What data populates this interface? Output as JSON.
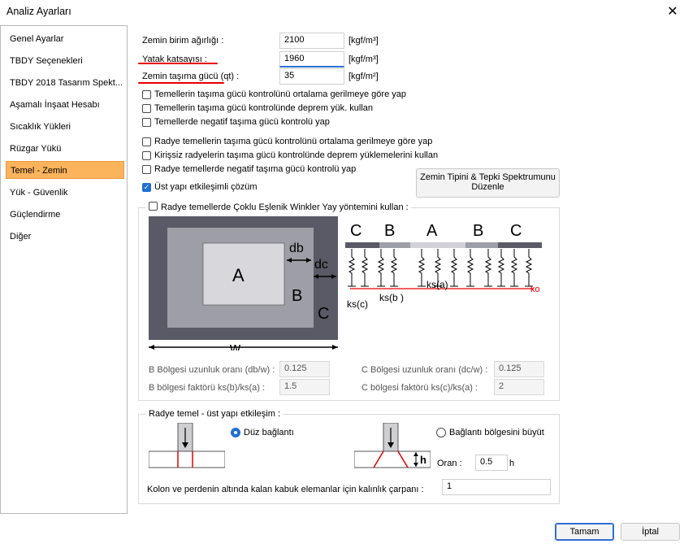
{
  "window": {
    "title": "Analiz Ayarları",
    "close_glyph": "✕"
  },
  "sidebar": {
    "items": [
      {
        "label": "Genel Ayarlar"
      },
      {
        "label": "TBDY Seçenekleri"
      },
      {
        "label": "TBDY 2018 Tasarım Spekt..."
      },
      {
        "label": "Aşamalı İnşaat Hesabı"
      },
      {
        "label": "Sıcaklık Yükleri"
      },
      {
        "label": "Rüzgar Yükü"
      },
      {
        "label": "Temel - Zemin"
      },
      {
        "label": "Yük - Güvenlik"
      },
      {
        "label": "Güçlendirme"
      },
      {
        "label": "Diğer"
      }
    ],
    "selected": "Temel - Zemin"
  },
  "soil": {
    "unit_weight": {
      "label": "Zemin birim ağırlığı :",
      "value": "2100",
      "unit": "[kgf/m³]"
    },
    "bed_coef": {
      "label": "Yatak katsayısı :",
      "value": "1960",
      "unit": "[kgf/m³]"
    },
    "bearing": {
      "label": "Zemin taşıma gücü (qt) :",
      "value": "35",
      "unit": "[kgf/m²]"
    }
  },
  "checks": {
    "c1": {
      "label": "Temellerin taşıma gücü kontrolünü ortalama gerilmeye göre yap",
      "checked": false
    },
    "c2": {
      "label": "Temellerin taşıma gücü kontrolünde deprem yük. kullan",
      "checked": false
    },
    "c3": {
      "label": "Temellerde negatif taşıma gücü kontrolü yap",
      "checked": false
    },
    "c4": {
      "label": "Radye temellerin taşıma gücü kontrolünü ortalama gerilmeye göre yap",
      "checked": false
    },
    "c5": {
      "label": "Kirişsiz radyelerin taşıma gücü kontrolünde deprem yüklemelerini kullan",
      "checked": false
    },
    "c6": {
      "label": "Radye temellerde negatif taşıma gücü kontrolü yap",
      "checked": false
    },
    "c7": {
      "label": "Üst yapı etkileşimli çözüm",
      "checked": true
    }
  },
  "spectrum_button": {
    "line1": "Zemin Tipini  & Tepki Spektrumunu",
    "line2": "Düzenle"
  },
  "winkler": {
    "title": "Radye temellerde Çoklu Eşlenik Winkler Yay yöntemini kullan :",
    "checked": false,
    "diagram": {
      "zone_a": "A",
      "zone_b": "B",
      "zone_c": "C",
      "db": "db",
      "dc": "dc",
      "w": "w",
      "top_c1": "C",
      "top_b1": "B",
      "top_a": "A",
      "top_b2": "B",
      "top_c2": "C",
      "ks_a": "ks(a)",
      "ks_b": "ks(b )",
      "ks_c": "ks(c)",
      "ko": "ko"
    },
    "b_ratio": {
      "label": "B Bölgesi uzunluk oranı (db/w) :",
      "value": "0.125"
    },
    "c_ratio": {
      "label": "C Bölgesi uzunluk oranı (dc/w) :",
      "value": "0.125"
    },
    "b_factor": {
      "label": "B bölgesi faktörü ks(b)/ks(a) :",
      "value": "1.5"
    },
    "c_factor": {
      "label": "C bölgesi faktörü ks(c)/ks(a) :",
      "value": "2"
    }
  },
  "raft": {
    "title": "Radye temel - üst yapı etkileşim :",
    "opt_direct": {
      "label": "Düz bağlantı",
      "selected": true
    },
    "opt_enlarge": {
      "label": "Bağlantı bölgesini büyüt",
      "selected": false
    },
    "ratio_label": "Oran :",
    "ratio_value": "0.5",
    "ratio_unit": "h",
    "h_label": "h",
    "thickness_label": "Kolon ve perdenin altında kalan kabuk elemanlar için kalınlık çarpanı :",
    "thickness_value": "1"
  },
  "footer": {
    "ok": "Tamam",
    "cancel": "İptal"
  },
  "colors": {
    "accent": "#fbb35c",
    "focus": "#2e6fd1",
    "underline": "#e60000",
    "check": "#1f6fd1"
  }
}
